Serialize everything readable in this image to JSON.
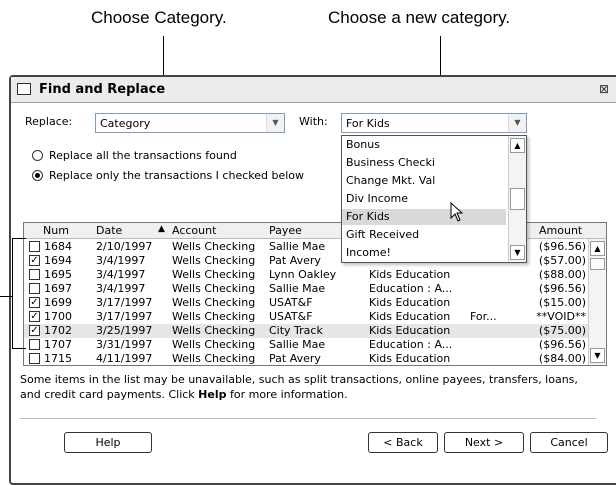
{
  "callouts": {
    "left": "Choose Category.",
    "right": "Choose a new category."
  },
  "window": {
    "title": "Find and Replace",
    "replace_label": "Replace:",
    "replace_value": "Category",
    "with_label": "With:",
    "with_value": "For Kids",
    "radio_all": "Replace all the transactions found",
    "radio_checked": "Replace only the transactions I checked below"
  },
  "dropdown": {
    "items": [
      "Bonus",
      "Business Checki",
      "Change Mkt. Val",
      "Div Income",
      "For Kids",
      "Gift Received",
      "Income!"
    ],
    "selected": "For Kids"
  },
  "grid": {
    "headers": {
      "num": "Num",
      "date": "Date",
      "sort_glyph": "▲",
      "account": "Account",
      "payee": "Payee",
      "amount": "Amount"
    },
    "rows": [
      {
        "checked": false,
        "num": "1684",
        "date": "2/10/1997",
        "account": "Wells Checking",
        "payee": "Sallie Mae",
        "category": "",
        "memo": "",
        "amount": "($96.56)"
      },
      {
        "checked": true,
        "num": "1694",
        "date": "3/4/1997",
        "account": "Wells Checking",
        "payee": "Pat Avery",
        "category": "",
        "memo": "",
        "amount": "($57.00)"
      },
      {
        "checked": false,
        "num": "1695",
        "date": "3/4/1997",
        "account": "Wells Checking",
        "payee": "Lynn Oakley",
        "category": "Kids Education",
        "memo": "",
        "amount": "($88.00)"
      },
      {
        "checked": false,
        "num": "1697",
        "date": "3/4/1997",
        "account": "Wells Checking",
        "payee": "Sallie Mae",
        "category": "Education : A...",
        "memo": "",
        "amount": "($96.56)"
      },
      {
        "checked": true,
        "num": "1699",
        "date": "3/17/1997",
        "account": "Wells Checking",
        "payee": "USAT&F",
        "category": "Kids Education",
        "memo": "",
        "amount": "($15.00)"
      },
      {
        "checked": true,
        "num": "1700",
        "date": "3/17/1997",
        "account": "Wells Checking",
        "payee": "USAT&F",
        "category": "Kids Education",
        "memo": "For...",
        "amount": "**VOID**"
      },
      {
        "checked": true,
        "num": "1702",
        "date": "3/25/1997",
        "account": "Wells Checking",
        "payee": "City Track",
        "category": "Kids Education",
        "memo": "",
        "amount": "($75.00)"
      },
      {
        "checked": false,
        "num": "1707",
        "date": "3/31/1997",
        "account": "Wells Checking",
        "payee": "Sallie Mae",
        "category": "Education : A...",
        "memo": "",
        "amount": "($96.56)"
      },
      {
        "checked": false,
        "num": "1715",
        "date": "4/11/1997",
        "account": "Wells Checking",
        "payee": "Pat Avery",
        "category": "Kids Education",
        "memo": "",
        "amount": "($84.00)"
      }
    ]
  },
  "info": {
    "text_before": "Some items in the list may be unavailable, such as split transactions, online payees, transfers, loans, and credit card payments. Click ",
    "help_word": "Help",
    "text_after": " for more information."
  },
  "buttons": {
    "help": "Help",
    "back": "< Back",
    "next": "Next >",
    "cancel": "Cancel"
  }
}
